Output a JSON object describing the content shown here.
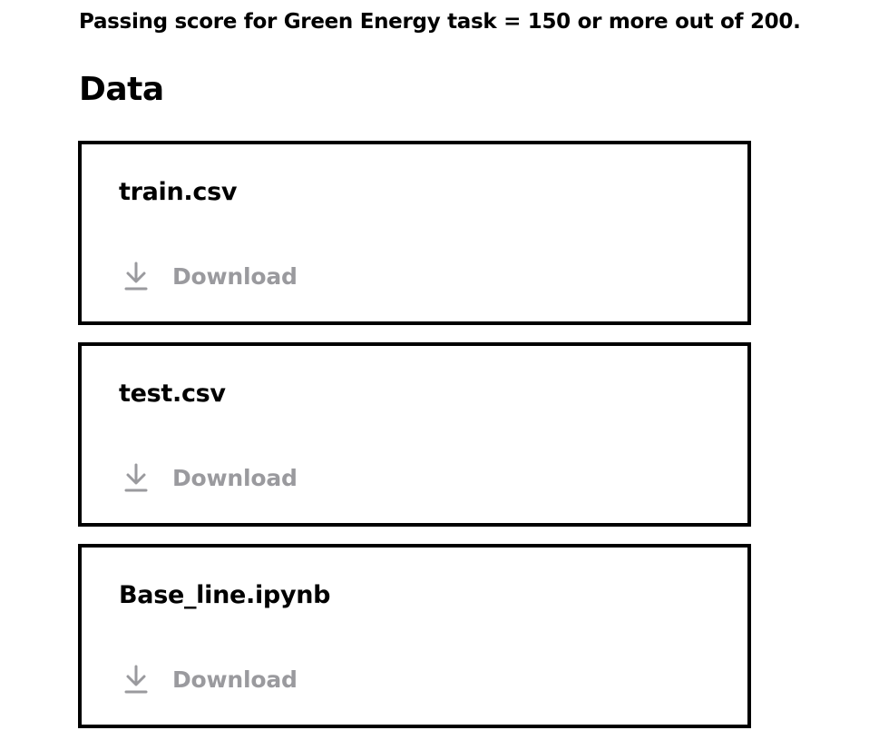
{
  "passing_note": "Passing score for Green Energy task = 150 or more out of 200.",
  "section_title": "Data",
  "files": [
    {
      "name": "train.csv",
      "action_label": "Download",
      "icon": "download-icon"
    },
    {
      "name": "test.csv",
      "action_label": "Download",
      "icon": "download-icon"
    },
    {
      "name": "Base_line.ipynb",
      "action_label": "Download",
      "icon": "download-icon"
    }
  ],
  "colors": {
    "text": "#000000",
    "muted": "#9a9a9e",
    "border": "#000000",
    "background": "#ffffff"
  }
}
